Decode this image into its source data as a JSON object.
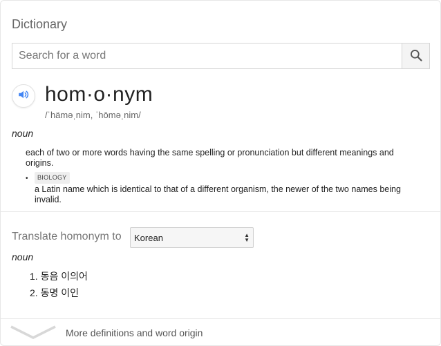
{
  "widget": {
    "title": "Dictionary"
  },
  "search": {
    "placeholder": "Search for a word",
    "value": ""
  },
  "entry": {
    "headword": "hom·o·nym",
    "phonetic": "/ˈhäməˌnim, ˈhōməˌnim/",
    "part_of_speech": "noun",
    "definition": "each of two or more words having the same spelling or pronunciation but different meanings and origins.",
    "sub_definition": {
      "domain": "BIOLOGY",
      "text": "a Latin name which is identical to that of a different organism, the newer of the two names being invalid."
    }
  },
  "translate": {
    "label": "Translate homonym to",
    "selected_language": "Korean",
    "part_of_speech": "noun",
    "items": [
      "동음 이의어",
      "동명 이인"
    ]
  },
  "more": {
    "label": "More definitions and word origin"
  },
  "icons": {
    "search": "search-icon",
    "audio": "speaker-icon",
    "expand": "chevron-down-icon"
  },
  "colors": {
    "accent": "#4285f4",
    "muted_text": "#777777"
  }
}
